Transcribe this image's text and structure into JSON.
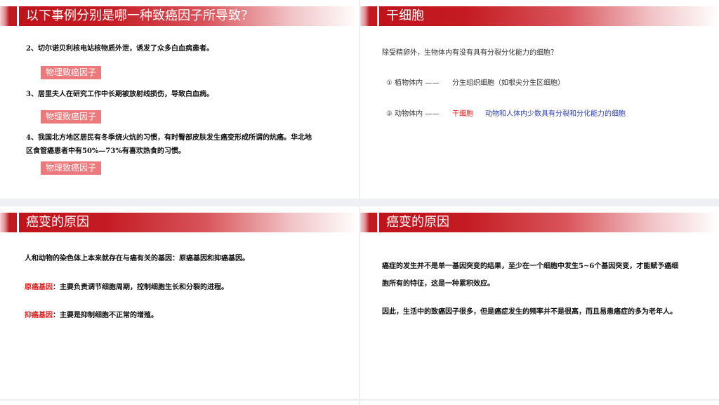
{
  "slides": [
    {
      "title": "以下事例分别是哪一种致癌因子所导致？",
      "items": [
        {
          "text": "2、切尔诺贝利核电站核物质外泄，诱发了众多白血病患者。",
          "tag": "物理致癌因子"
        },
        {
          "text": "3、居里夫人在研究工作中长期被放射线损伤，导致白血病。",
          "tag": "物理致癌因子"
        },
        {
          "text_line1": "4、我国北方地区居民有冬季烧火炕的习惯，有时臀部皮肤发生癌变形成所谓的炕癌。华北地",
          "text_line2": "区食管癌患者中有50%—73%有喜欢热食的习惯。",
          "tag": "物理致癌因子"
        }
      ]
    },
    {
      "title": "干细胞",
      "question": "除受精卵外，生物体内有没有具有分裂分化能力的细胞？",
      "row1": {
        "label": "① 植物体内 ——",
        "answer": "分生组织细胞（如根尖分生区细胞）"
      },
      "row2": {
        "label": "② 动物体内 ——",
        "answer_red": "干细胞",
        "answer_blue": "动物和人体内少数具有分裂和分化能力的细胞"
      }
    },
    {
      "title": "癌变的原因",
      "line1": "人和动物的染色体上本来就存在与癌有关的基因：原癌基因和抑癌基因。",
      "proto_label": "原癌基因",
      "proto_text": "：主要负责调节细胞周期，控制细胞生长和分裂的进程。",
      "suppressor_label": "抑癌基因",
      "suppressor_text": "：主要是抑制细胞不正常的增殖。"
    },
    {
      "title": "癌变的原因",
      "para1_line1": "癌症的发生并不是单一基因突变的结果，至少在一个细胞中发生5~6个基因突变，才能赋予癌细",
      "para1_line2": "胞所有的特征，这是一种累积效应。",
      "para2": "因此，生活中的致癌因子很多，但是癌症发生的频率并不是很高，而且易患癌症的多为老年人。"
    }
  ],
  "colors": {
    "accent_red": "#c0141c",
    "tag_bg": "#ec7a7d",
    "highlight_red": "#e02020",
    "highlight_blue": "#2f3fb5"
  }
}
